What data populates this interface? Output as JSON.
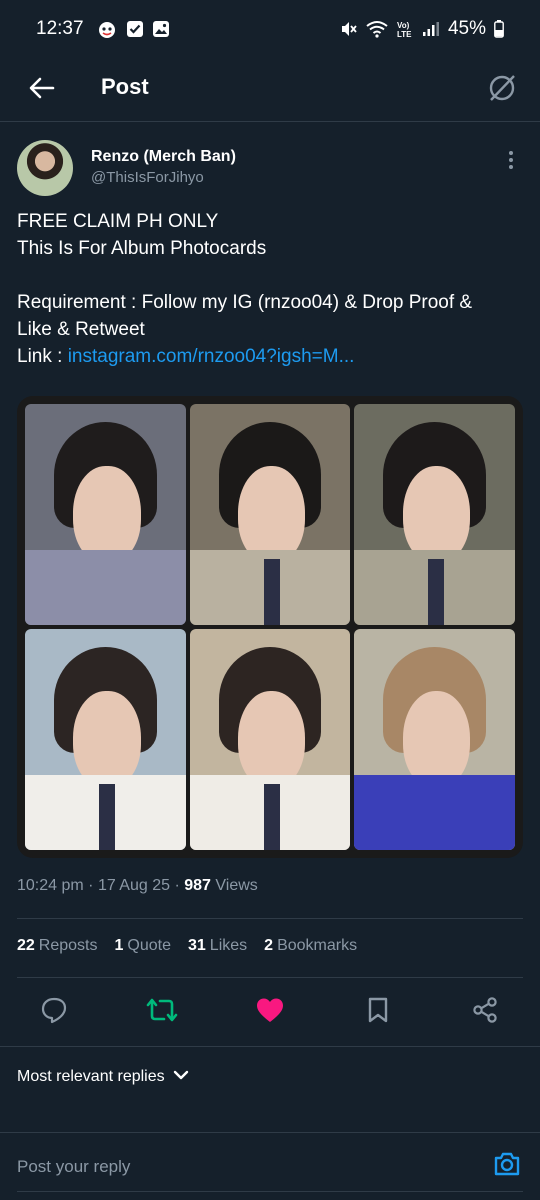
{
  "status_bar": {
    "time": "12:37",
    "battery": "45%",
    "icons": [
      "notification-app-icon",
      "checkbox-icon",
      "gallery-icon",
      "mute-icon",
      "wifi-icon",
      "volte-icon",
      "signal-icon",
      "battery-icon"
    ]
  },
  "header": {
    "title": "Post",
    "back_icon": "back-arrow-icon",
    "grok_icon": "grok-icon"
  },
  "author": {
    "name": "Renzo (Merch Ban)",
    "handle": "@ThisIsForJihyo"
  },
  "tweet": {
    "line1": "FREE CLAIM PH ONLY",
    "line2": "This Is For Album Photocards",
    "line3": "Requirement : Follow my IG (rnzoo04) & Drop Proof &",
    "line4": "Like & Retweet",
    "link_prefix": "Link : ",
    "link_text": "instagram.com/rnzoo04?igsh=M..."
  },
  "meta": {
    "time": "10:24 pm",
    "sep1": " · ",
    "date": "17 Aug 25",
    "sep2": " · ",
    "views_count": "987",
    "views_label": " Views"
  },
  "stats": {
    "reposts_count": "22",
    "reposts_label": "Reposts",
    "quotes_count": "1",
    "quotes_label": "Quote",
    "likes_count": "31",
    "likes_label": "Likes",
    "bookmarks_count": "2",
    "bookmarks_label": "Bookmarks"
  },
  "actions": {
    "reply_icon": "reply-icon",
    "repost_icon": "repost-icon",
    "like_icon": "heart-icon",
    "bookmark_icon": "bookmark-icon",
    "share_icon": "share-icon",
    "colors": {
      "repost": "#00ba7c",
      "like": "#f91880",
      "default": "#8b98a5"
    }
  },
  "replies": {
    "sort_label": "Most relevant replies",
    "reply_placeholder": "Post your reply"
  },
  "colors": {
    "background": "#15202b",
    "link": "#1d9bf0",
    "secondary_text": "#8b98a5"
  }
}
